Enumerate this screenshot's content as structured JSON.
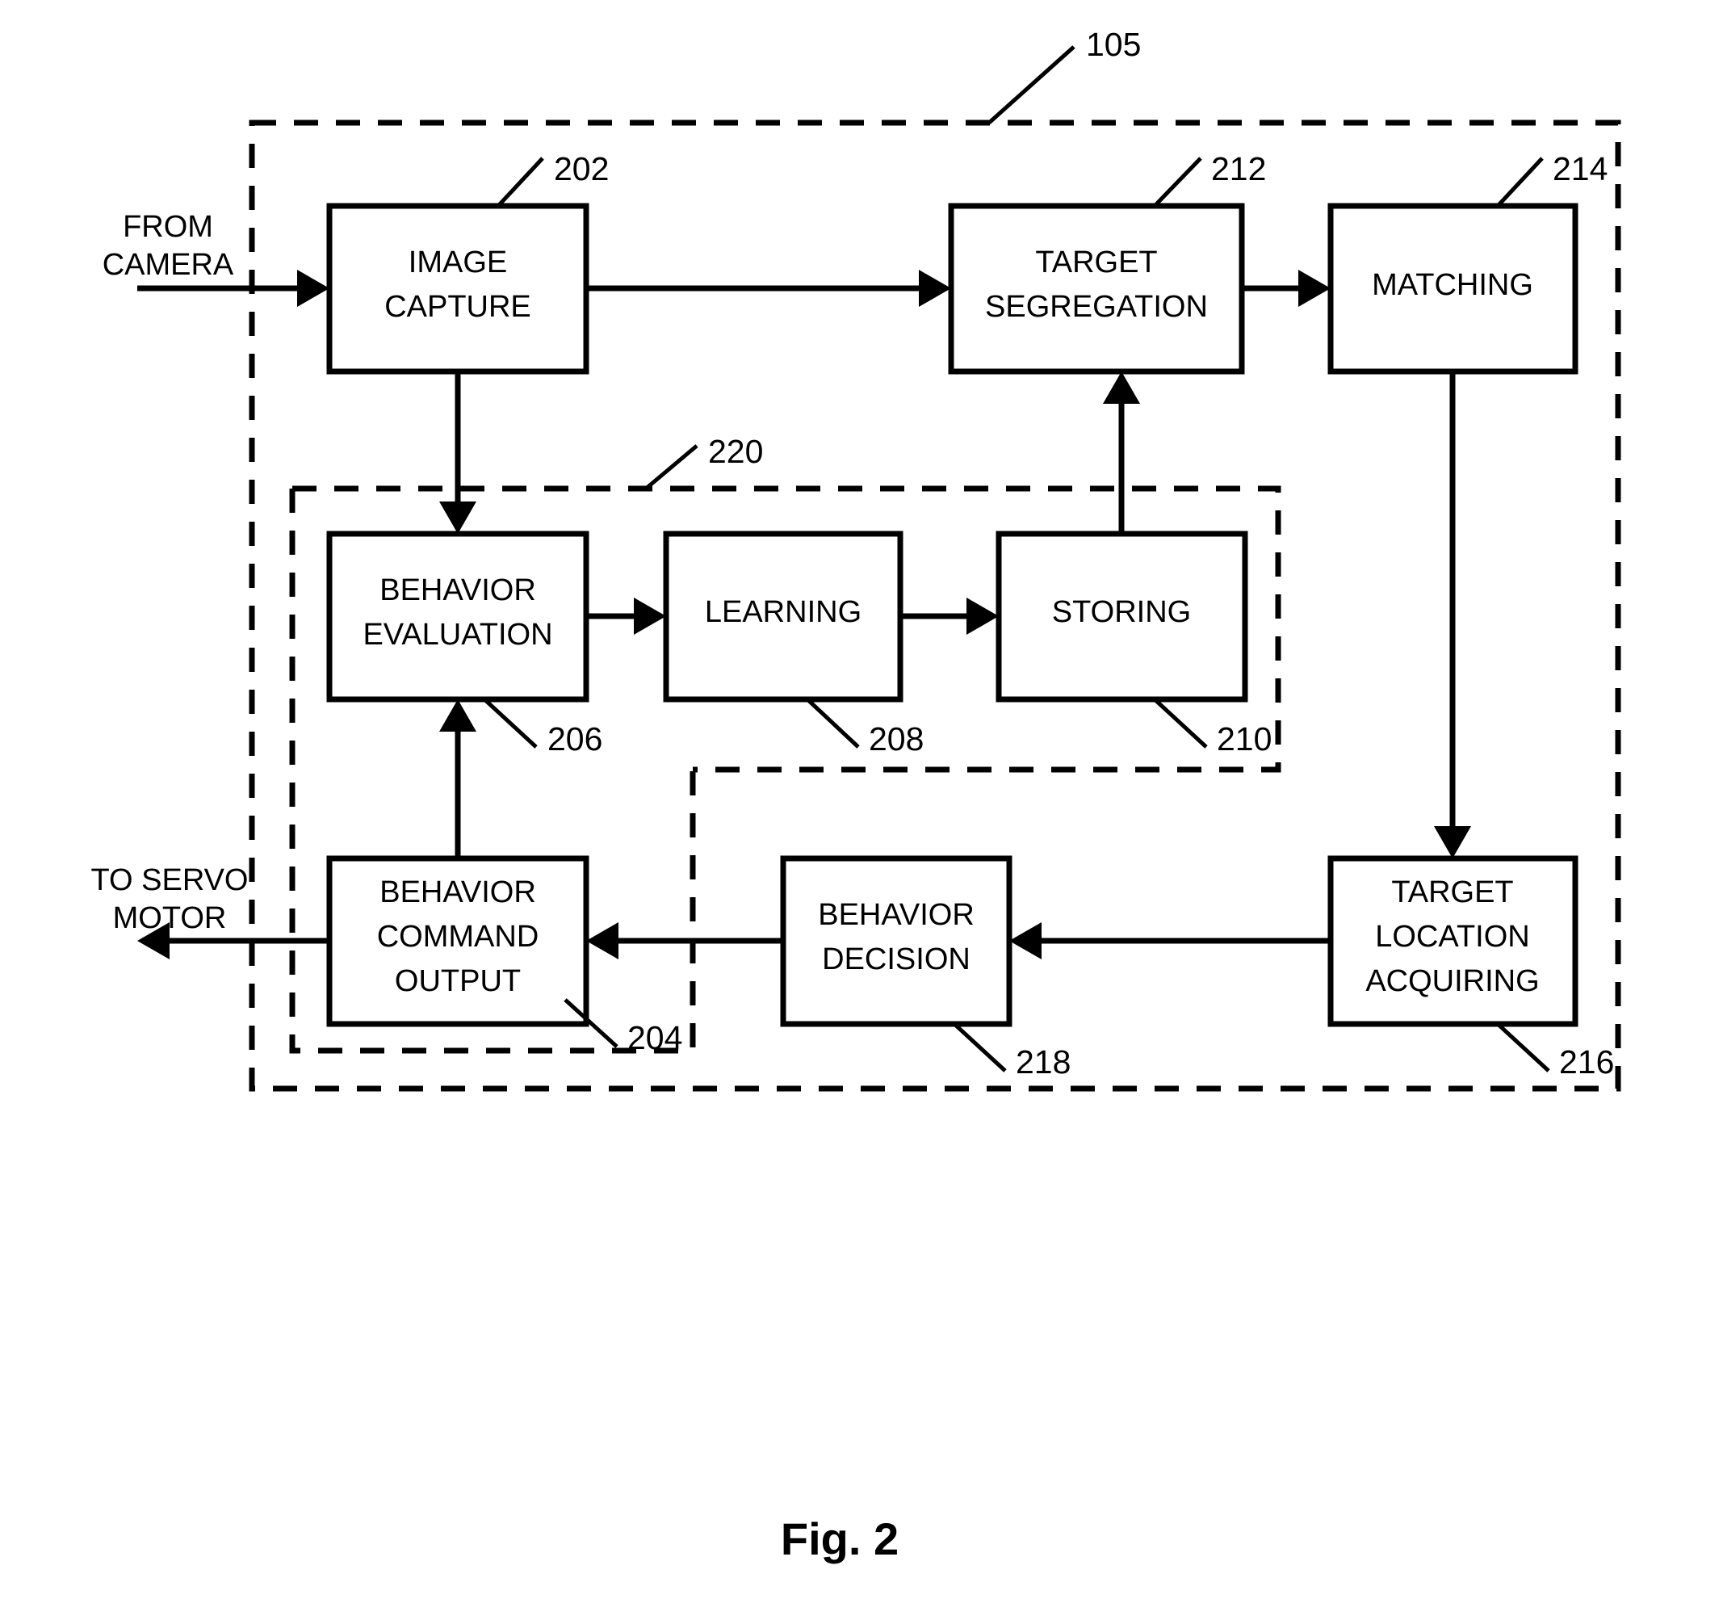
{
  "figure": {
    "caption": "Fig. 2",
    "outer_ref": "105",
    "inner_ref": "220",
    "command_ref": "204"
  },
  "io_labels": {
    "input_line1": "FROM",
    "input_line2": "CAMERA",
    "output_line1": "TO SERVO",
    "output_line2": "MOTOR"
  },
  "blocks": [
    {
      "id": "image-capture",
      "line1": "IMAGE",
      "line2": "CAPTURE",
      "line3": "",
      "ref": "202"
    },
    {
      "id": "target-segregation",
      "line1": "TARGET",
      "line2": "SEGREGATION",
      "line3": "",
      "ref": "212"
    },
    {
      "id": "matching",
      "line1": "MATCHING",
      "line2": "",
      "line3": "",
      "ref": "214"
    },
    {
      "id": "behavior-evaluation",
      "line1": "BEHAVIOR",
      "line2": "EVALUATION",
      "line3": "",
      "ref": "206"
    },
    {
      "id": "learning",
      "line1": "LEARNING",
      "line2": "",
      "line3": "",
      "ref": "208"
    },
    {
      "id": "storing",
      "line1": "STORING",
      "line2": "",
      "line3": "",
      "ref": "210"
    },
    {
      "id": "behavior-command-output",
      "line1": "BEHAVIOR",
      "line2": "COMMAND",
      "line3": "OUTPUT",
      "ref": "204"
    },
    {
      "id": "behavior-decision",
      "line1": "BEHAVIOR",
      "line2": "DECISION",
      "line3": "",
      "ref": "218"
    },
    {
      "id": "target-location-acquiring",
      "line1": "TARGET",
      "line2": "LOCATION",
      "line3": "ACQUIRING",
      "ref": "216"
    }
  ],
  "colors": {
    "ink": "#000000",
    "paper": "#ffffff"
  }
}
